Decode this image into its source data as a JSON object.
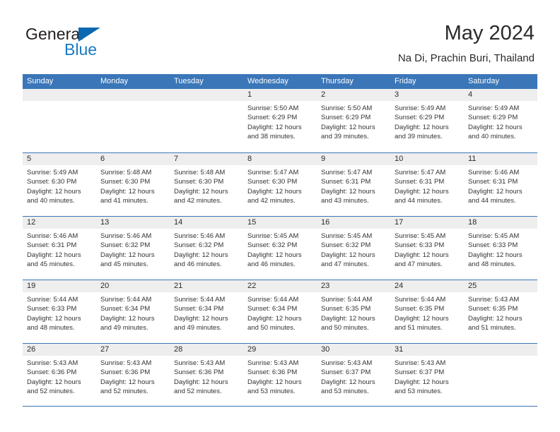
{
  "brand": {
    "name_top": "General",
    "name_bottom": "Blue"
  },
  "header": {
    "title": "May 2024",
    "location": "Na Di, Prachin Buri, Thailand"
  },
  "colors": {
    "header_blue": "#3a76b8",
    "logo_blue": "#1a7ac4",
    "day_band_gray": "#eeeeee"
  },
  "weekdays": [
    "Sunday",
    "Monday",
    "Tuesday",
    "Wednesday",
    "Thursday",
    "Friday",
    "Saturday"
  ],
  "weeks": [
    [
      {
        "day": "",
        "empty": true,
        "sunrise": "",
        "sunset": "",
        "daylight_line1": "",
        "daylight_line2": ""
      },
      {
        "day": "",
        "empty": true,
        "sunrise": "",
        "sunset": "",
        "daylight_line1": "",
        "daylight_line2": ""
      },
      {
        "day": "",
        "empty": true,
        "sunrise": "",
        "sunset": "",
        "daylight_line1": "",
        "daylight_line2": ""
      },
      {
        "day": "1",
        "sunrise": "Sunrise: 5:50 AM",
        "sunset": "Sunset: 6:29 PM",
        "daylight_line1": "Daylight: 12 hours",
        "daylight_line2": "and 38 minutes."
      },
      {
        "day": "2",
        "sunrise": "Sunrise: 5:50 AM",
        "sunset": "Sunset: 6:29 PM",
        "daylight_line1": "Daylight: 12 hours",
        "daylight_line2": "and 39 minutes."
      },
      {
        "day": "3",
        "sunrise": "Sunrise: 5:49 AM",
        "sunset": "Sunset: 6:29 PM",
        "daylight_line1": "Daylight: 12 hours",
        "daylight_line2": "and 39 minutes."
      },
      {
        "day": "4",
        "sunrise": "Sunrise: 5:49 AM",
        "sunset": "Sunset: 6:29 PM",
        "daylight_line1": "Daylight: 12 hours",
        "daylight_line2": "and 40 minutes."
      }
    ],
    [
      {
        "day": "5",
        "sunrise": "Sunrise: 5:49 AM",
        "sunset": "Sunset: 6:30 PM",
        "daylight_line1": "Daylight: 12 hours",
        "daylight_line2": "and 40 minutes."
      },
      {
        "day": "6",
        "sunrise": "Sunrise: 5:48 AM",
        "sunset": "Sunset: 6:30 PM",
        "daylight_line1": "Daylight: 12 hours",
        "daylight_line2": "and 41 minutes."
      },
      {
        "day": "7",
        "sunrise": "Sunrise: 5:48 AM",
        "sunset": "Sunset: 6:30 PM",
        "daylight_line1": "Daylight: 12 hours",
        "daylight_line2": "and 42 minutes."
      },
      {
        "day": "8",
        "sunrise": "Sunrise: 5:47 AM",
        "sunset": "Sunset: 6:30 PM",
        "daylight_line1": "Daylight: 12 hours",
        "daylight_line2": "and 42 minutes."
      },
      {
        "day": "9",
        "sunrise": "Sunrise: 5:47 AM",
        "sunset": "Sunset: 6:31 PM",
        "daylight_line1": "Daylight: 12 hours",
        "daylight_line2": "and 43 minutes."
      },
      {
        "day": "10",
        "sunrise": "Sunrise: 5:47 AM",
        "sunset": "Sunset: 6:31 PM",
        "daylight_line1": "Daylight: 12 hours",
        "daylight_line2": "and 44 minutes."
      },
      {
        "day": "11",
        "sunrise": "Sunrise: 5:46 AM",
        "sunset": "Sunset: 6:31 PM",
        "daylight_line1": "Daylight: 12 hours",
        "daylight_line2": "and 44 minutes."
      }
    ],
    [
      {
        "day": "12",
        "sunrise": "Sunrise: 5:46 AM",
        "sunset": "Sunset: 6:31 PM",
        "daylight_line1": "Daylight: 12 hours",
        "daylight_line2": "and 45 minutes."
      },
      {
        "day": "13",
        "sunrise": "Sunrise: 5:46 AM",
        "sunset": "Sunset: 6:32 PM",
        "daylight_line1": "Daylight: 12 hours",
        "daylight_line2": "and 45 minutes."
      },
      {
        "day": "14",
        "sunrise": "Sunrise: 5:46 AM",
        "sunset": "Sunset: 6:32 PM",
        "daylight_line1": "Daylight: 12 hours",
        "daylight_line2": "and 46 minutes."
      },
      {
        "day": "15",
        "sunrise": "Sunrise: 5:45 AM",
        "sunset": "Sunset: 6:32 PM",
        "daylight_line1": "Daylight: 12 hours",
        "daylight_line2": "and 46 minutes."
      },
      {
        "day": "16",
        "sunrise": "Sunrise: 5:45 AM",
        "sunset": "Sunset: 6:32 PM",
        "daylight_line1": "Daylight: 12 hours",
        "daylight_line2": "and 47 minutes."
      },
      {
        "day": "17",
        "sunrise": "Sunrise: 5:45 AM",
        "sunset": "Sunset: 6:33 PM",
        "daylight_line1": "Daylight: 12 hours",
        "daylight_line2": "and 47 minutes."
      },
      {
        "day": "18",
        "sunrise": "Sunrise: 5:45 AM",
        "sunset": "Sunset: 6:33 PM",
        "daylight_line1": "Daylight: 12 hours",
        "daylight_line2": "and 48 minutes."
      }
    ],
    [
      {
        "day": "19",
        "sunrise": "Sunrise: 5:44 AM",
        "sunset": "Sunset: 6:33 PM",
        "daylight_line1": "Daylight: 12 hours",
        "daylight_line2": "and 48 minutes."
      },
      {
        "day": "20",
        "sunrise": "Sunrise: 5:44 AM",
        "sunset": "Sunset: 6:34 PM",
        "daylight_line1": "Daylight: 12 hours",
        "daylight_line2": "and 49 minutes."
      },
      {
        "day": "21",
        "sunrise": "Sunrise: 5:44 AM",
        "sunset": "Sunset: 6:34 PM",
        "daylight_line1": "Daylight: 12 hours",
        "daylight_line2": "and 49 minutes."
      },
      {
        "day": "22",
        "sunrise": "Sunrise: 5:44 AM",
        "sunset": "Sunset: 6:34 PM",
        "daylight_line1": "Daylight: 12 hours",
        "daylight_line2": "and 50 minutes."
      },
      {
        "day": "23",
        "sunrise": "Sunrise: 5:44 AM",
        "sunset": "Sunset: 6:35 PM",
        "daylight_line1": "Daylight: 12 hours",
        "daylight_line2": "and 50 minutes."
      },
      {
        "day": "24",
        "sunrise": "Sunrise: 5:44 AM",
        "sunset": "Sunset: 6:35 PM",
        "daylight_line1": "Daylight: 12 hours",
        "daylight_line2": "and 51 minutes."
      },
      {
        "day": "25",
        "sunrise": "Sunrise: 5:43 AM",
        "sunset": "Sunset: 6:35 PM",
        "daylight_line1": "Daylight: 12 hours",
        "daylight_line2": "and 51 minutes."
      }
    ],
    [
      {
        "day": "26",
        "sunrise": "Sunrise: 5:43 AM",
        "sunset": "Sunset: 6:36 PM",
        "daylight_line1": "Daylight: 12 hours",
        "daylight_line2": "and 52 minutes."
      },
      {
        "day": "27",
        "sunrise": "Sunrise: 5:43 AM",
        "sunset": "Sunset: 6:36 PM",
        "daylight_line1": "Daylight: 12 hours",
        "daylight_line2": "and 52 minutes."
      },
      {
        "day": "28",
        "sunrise": "Sunrise: 5:43 AM",
        "sunset": "Sunset: 6:36 PM",
        "daylight_line1": "Daylight: 12 hours",
        "daylight_line2": "and 52 minutes."
      },
      {
        "day": "29",
        "sunrise": "Sunrise: 5:43 AM",
        "sunset": "Sunset: 6:36 PM",
        "daylight_line1": "Daylight: 12 hours",
        "daylight_line2": "and 53 minutes."
      },
      {
        "day": "30",
        "sunrise": "Sunrise: 5:43 AM",
        "sunset": "Sunset: 6:37 PM",
        "daylight_line1": "Daylight: 12 hours",
        "daylight_line2": "and 53 minutes."
      },
      {
        "day": "31",
        "sunrise": "Sunrise: 5:43 AM",
        "sunset": "Sunset: 6:37 PM",
        "daylight_line1": "Daylight: 12 hours",
        "daylight_line2": "and 53 minutes."
      },
      {
        "day": "",
        "empty": true,
        "sunrise": "",
        "sunset": "",
        "daylight_line1": "",
        "daylight_line2": ""
      }
    ]
  ]
}
